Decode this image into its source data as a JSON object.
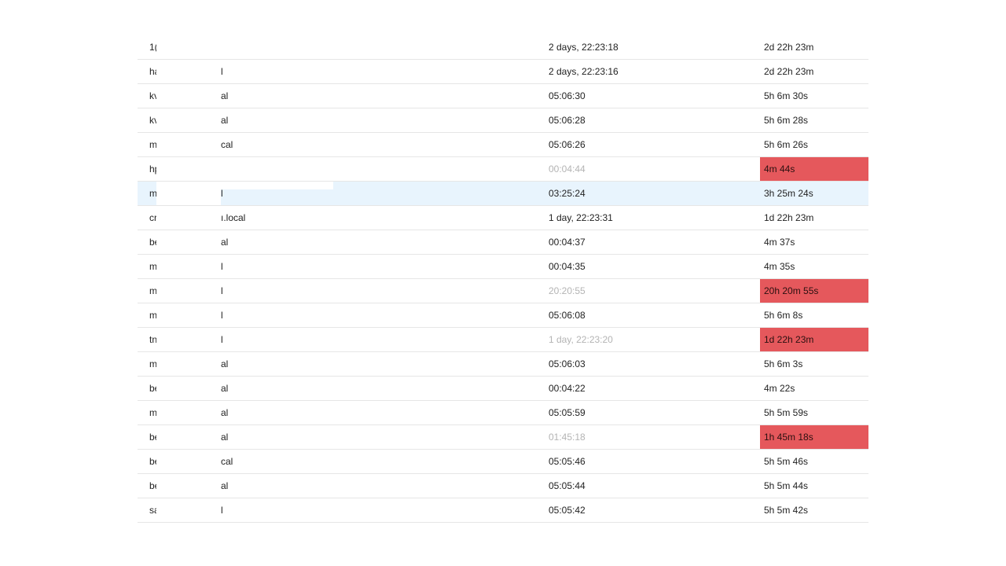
{
  "rows": [
    {
      "prefix": "1(",
      "suffix": "",
      "uptime": "2 days, 22:23:18",
      "duration": "2d 22h 23m",
      "stale": false
    },
    {
      "prefix": "ha",
      "suffix": "l",
      "uptime": "2 days, 22:23:16",
      "duration": "2d 22h 23m",
      "stale": false
    },
    {
      "prefix": "kv",
      "suffix": "al",
      "uptime": "05:06:30",
      "duration": "5h 6m 30s",
      "stale": false
    },
    {
      "prefix": "kv",
      "suffix": "al",
      "uptime": "05:06:28",
      "duration": "5h 6m 28s",
      "stale": false
    },
    {
      "prefix": "m",
      "suffix": "cal",
      "uptime": "05:06:26",
      "duration": "5h 6m 26s",
      "stale": false
    },
    {
      "prefix": "hp",
      "suffix": "",
      "uptime": "00:04:44",
      "duration": "4m 44s",
      "stale": true
    },
    {
      "prefix": "m",
      "suffix": "l",
      "uptime": "03:25:24",
      "duration": "3h 25m 24s",
      "stale": false,
      "selected": true
    },
    {
      "prefix": "cr",
      "suffix": "ı.local",
      "uptime": "1 day, 22:23:31",
      "duration": "1d 22h 23m",
      "stale": false
    },
    {
      "prefix": "be",
      "suffix": "al",
      "uptime": "00:04:37",
      "duration": "4m 37s",
      "stale": false
    },
    {
      "prefix": "m",
      "suffix": "l",
      "uptime": "00:04:35",
      "duration": "4m 35s",
      "stale": false
    },
    {
      "prefix": "m",
      "suffix": "l",
      "uptime": "20:20:55",
      "duration": "20h 20m 55s",
      "stale": true
    },
    {
      "prefix": "m",
      "suffix": "l",
      "uptime": "05:06:08",
      "duration": "5h 6m 8s",
      "stale": false
    },
    {
      "prefix": "tn",
      "suffix": "l",
      "uptime": "1 day, 22:23:20",
      "duration": "1d 22h 23m",
      "stale": true
    },
    {
      "prefix": "m",
      "suffix": "al",
      "uptime": "05:06:03",
      "duration": "5h 6m 3s",
      "stale": false
    },
    {
      "prefix": "be",
      "suffix": "al",
      "uptime": "00:04:22",
      "duration": "4m 22s",
      "stale": false
    },
    {
      "prefix": "m",
      "suffix": "al",
      "uptime": "05:05:59",
      "duration": "5h 5m 59s",
      "stale": false
    },
    {
      "prefix": "be",
      "suffix": "al",
      "uptime": "01:45:18",
      "duration": "1h 45m 18s",
      "stale": true
    },
    {
      "prefix": "be",
      "suffix": "cal",
      "uptime": "05:05:46",
      "duration": "5h 5m 46s",
      "stale": false
    },
    {
      "prefix": "be",
      "suffix": "al",
      "uptime": "05:05:44",
      "duration": "5h 5m 44s",
      "stale": false
    },
    {
      "prefix": "sa",
      "suffix": "l",
      "uptime": "05:05:42",
      "duration": "5h 5m 42s",
      "stale": false
    }
  ],
  "colors": {
    "stale_badge": "#e5585c",
    "selected_row": "#e8f4fd",
    "stale_text": "#b4b4b4"
  }
}
